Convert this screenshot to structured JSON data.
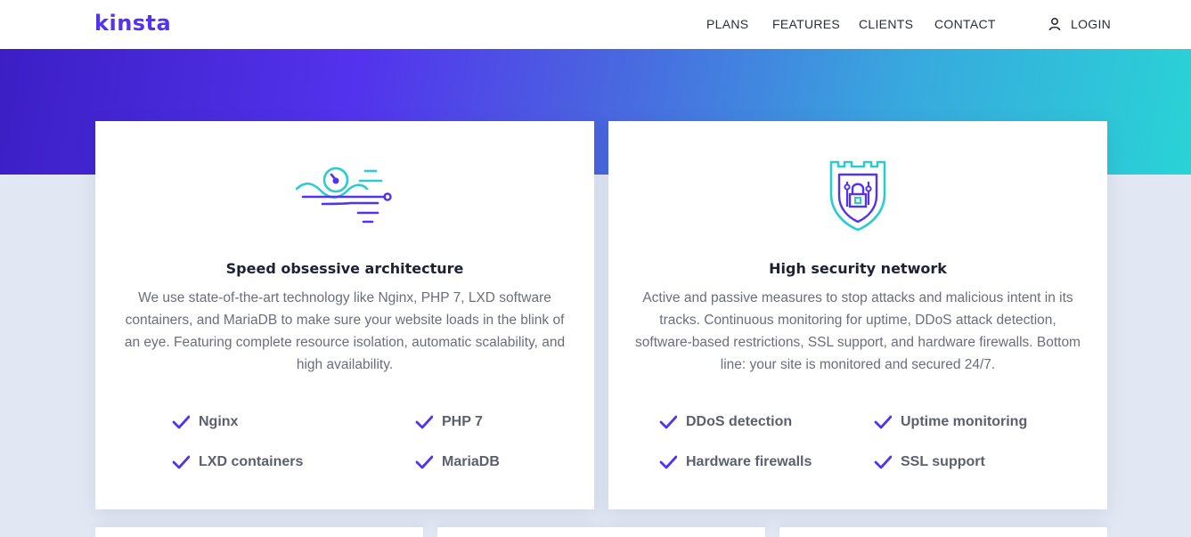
{
  "header": {
    "logo_text": "kinsta",
    "nav": [
      "PLANS",
      "FEATURES",
      "CLIENTS",
      "CONTACT"
    ],
    "login_label": "LOGIN"
  },
  "cards": [
    {
      "title": "Speed obsessive architecture",
      "description": "We use state-of-the-art technology like Nginx, PHP 7, LXD software containers, and MariaDB to make sure your website loads in the blink of an eye. Featuring complete resource isolation, automatic scalability, and high availability.",
      "features": [
        "Nginx",
        "PHP 7",
        "LXD containers",
        "MariaDB"
      ]
    },
    {
      "title": "High security network",
      "description": "Active and passive measures to stop attacks and malicious intent in its tracks. Continuous monitoring for uptime, DDoS attack detection, software-based restrictions, SSL support, and hardware firewalls. Bottom line: your site is monitored and secured 24/7.",
      "features": [
        "DDoS detection",
        "Uptime monitoring",
        "Hardware firewalls",
        "SSL support"
      ]
    }
  ],
  "colors": {
    "brand": "#5333ed",
    "accent": "#2bcbd0",
    "background": "#e2e8f3"
  }
}
